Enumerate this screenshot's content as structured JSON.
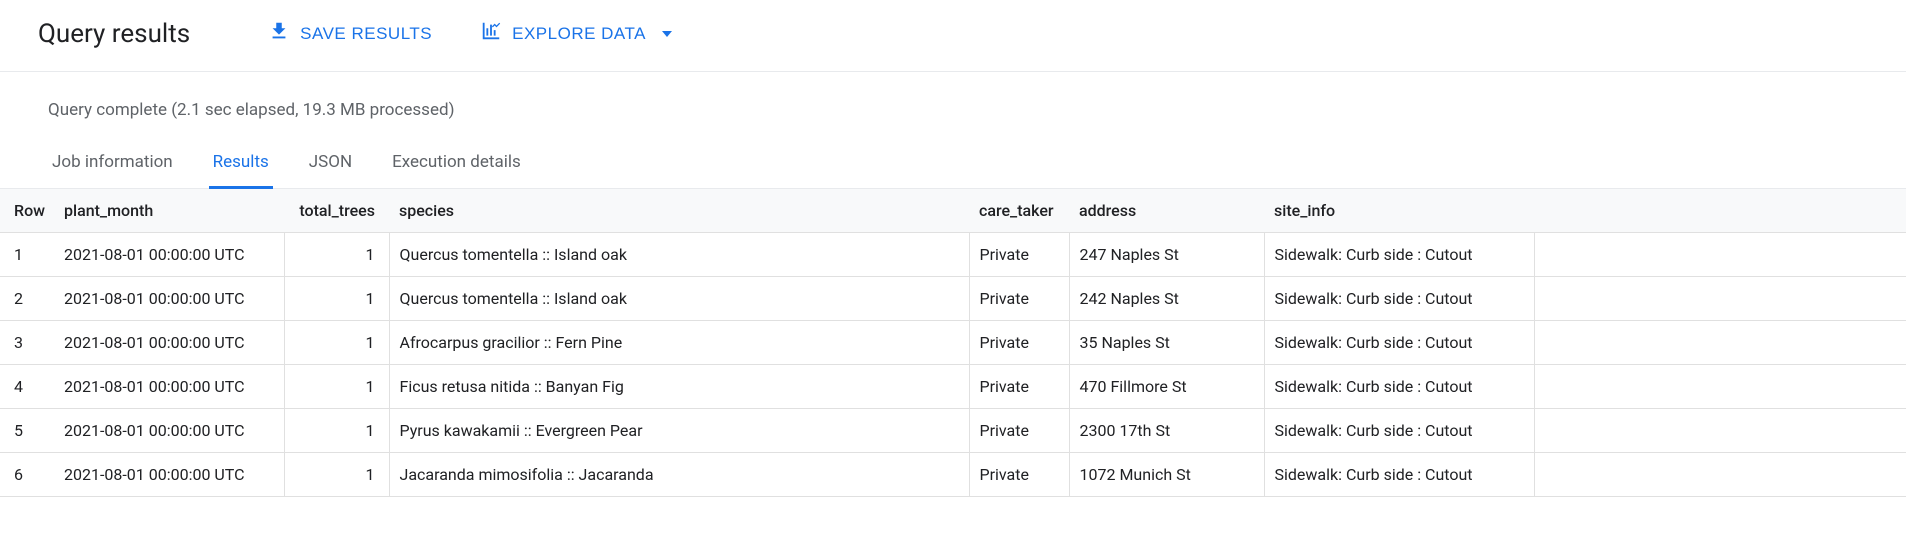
{
  "header": {
    "title": "Query results",
    "save_label": "SAVE RESULTS",
    "explore_label": "EXPLORE DATA"
  },
  "status": {
    "text": "Query complete (2.1 sec elapsed, 19.3 MB processed)"
  },
  "tabs": {
    "items": [
      {
        "label": "Job information",
        "active": false
      },
      {
        "label": "Results",
        "active": true
      },
      {
        "label": "JSON",
        "active": false
      },
      {
        "label": "Execution details",
        "active": false
      }
    ]
  },
  "table": {
    "columns": [
      "Row",
      "plant_month",
      "total_trees",
      "species",
      "care_taker",
      "address",
      "site_info"
    ],
    "rows": [
      {
        "row": "1",
        "plant_month": "2021-08-01 00:00:00 UTC",
        "total_trees": "1",
        "species": "Quercus tomentella :: Island oak",
        "care_taker": "Private",
        "address": "247 Naples St",
        "site_info": "Sidewalk: Curb side : Cutout"
      },
      {
        "row": "2",
        "plant_month": "2021-08-01 00:00:00 UTC",
        "total_trees": "1",
        "species": "Quercus tomentella :: Island oak",
        "care_taker": "Private",
        "address": "242 Naples St",
        "site_info": "Sidewalk: Curb side : Cutout"
      },
      {
        "row": "3",
        "plant_month": "2021-08-01 00:00:00 UTC",
        "total_trees": "1",
        "species": "Afrocarpus gracilior :: Fern Pine",
        "care_taker": "Private",
        "address": "35 Naples St",
        "site_info": "Sidewalk: Curb side : Cutout"
      },
      {
        "row": "4",
        "plant_month": "2021-08-01 00:00:00 UTC",
        "total_trees": "1",
        "species": "Ficus retusa nitida :: Banyan Fig",
        "care_taker": "Private",
        "address": "470 Fillmore St",
        "site_info": "Sidewalk: Curb side : Cutout"
      },
      {
        "row": "5",
        "plant_month": "2021-08-01 00:00:00 UTC",
        "total_trees": "1",
        "species": "Pyrus kawakamii :: Evergreen Pear",
        "care_taker": "Private",
        "address": "2300 17th St",
        "site_info": "Sidewalk: Curb side : Cutout"
      },
      {
        "row": "6",
        "plant_month": "2021-08-01 00:00:00 UTC",
        "total_trees": "1",
        "species": "Jacaranda mimosifolia :: Jacaranda",
        "care_taker": "Private",
        "address": "1072 Munich St",
        "site_info": "Sidewalk: Curb side : Cutout"
      }
    ]
  }
}
